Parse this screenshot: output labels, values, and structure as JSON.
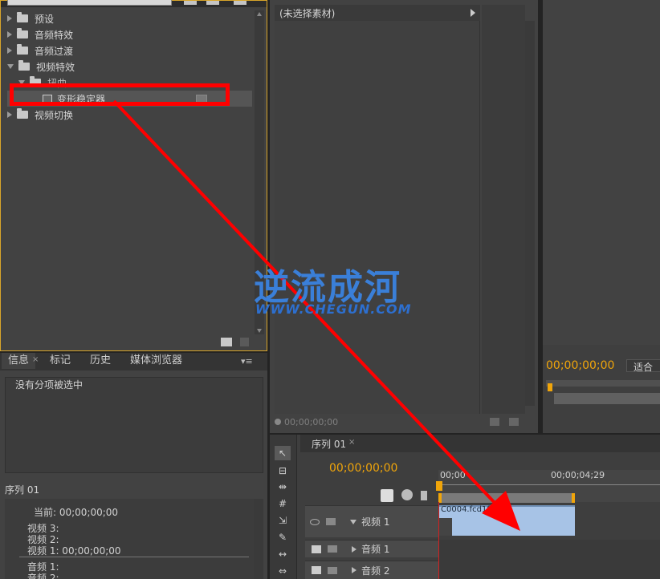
{
  "effects_panel": {
    "search_value": "变形稳定器",
    "items": [
      {
        "label": "预设",
        "expanded": false
      },
      {
        "label": "音频特效",
        "expanded": false
      },
      {
        "label": "音频过渡",
        "expanded": false
      },
      {
        "label": "视频特效",
        "expanded": true
      },
      {
        "label": "扭曲",
        "expanded": true
      },
      {
        "label": "变形稳定器"
      },
      {
        "label": "视频切换",
        "expanded": false
      }
    ]
  },
  "source_panel": {
    "clip_label": "(未选择素材)",
    "timecode": "00;00;00;00"
  },
  "program_panel": {
    "timecode": "00;00;00;00",
    "fit_label": "适合"
  },
  "info_panel": {
    "tabs": [
      "信息",
      "标记",
      "历史",
      "媒体浏览器"
    ],
    "empty_text": "没有分项被选中",
    "sequence_label": "序列 01",
    "current_label": "当前: 00;00;00;00",
    "lines": [
      "视频 3:",
      "视频 2:",
      "视频 1: 00;00;00;00",
      "音频 1:",
      "音频 2:"
    ]
  },
  "timeline": {
    "tab": "序列 01",
    "timecode": "00;00;00;00",
    "ruler_start": "00;00",
    "ruler_mid": "00;00;04;29",
    "tracks": [
      {
        "label": "视频 1"
      },
      {
        "label": "音频 1"
      },
      {
        "label": "音频 2"
      }
    ],
    "clip_label": "C0004.fcd1f1e..."
  },
  "watermark": {
    "title": "逆流成河",
    "url": "WWW.CHEGUN.COM"
  },
  "colors": {
    "accent": "#f0a50a",
    "highlight": "#ff0000",
    "clip": "#a7c3e6"
  }
}
